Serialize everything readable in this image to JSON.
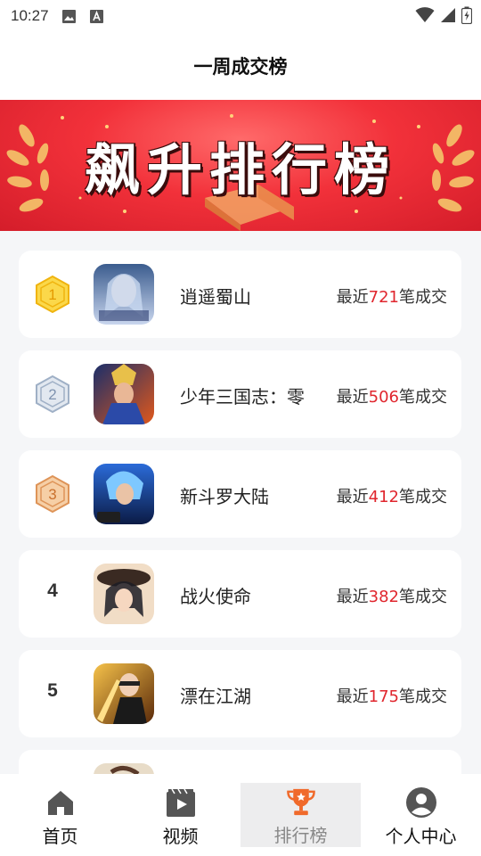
{
  "status_bar": {
    "time": "10:27"
  },
  "header": {
    "title": "一周成交榜"
  },
  "banner": {
    "text": "飙升排行榜"
  },
  "ranking": [
    {
      "rank": "1",
      "name": "逍遥蜀山",
      "prefix": "最近",
      "count": "721",
      "suffix": "笔成交"
    },
    {
      "rank": "2",
      "name": "少年三国志：零",
      "prefix": "最近",
      "count": "506",
      "suffix": "笔成交"
    },
    {
      "rank": "3",
      "name": "新斗罗大陆",
      "prefix": "最近",
      "count": "412",
      "suffix": "笔成交"
    },
    {
      "rank": "4",
      "name": "战火使命",
      "prefix": "最近",
      "count": "382",
      "suffix": "笔成交"
    },
    {
      "rank": "5",
      "name": "漂在江湖",
      "prefix": "最近",
      "count": "175",
      "suffix": "笔成交"
    }
  ],
  "tabs": [
    {
      "label": "首页",
      "icon": "home-icon"
    },
    {
      "label": "视频",
      "icon": "video-icon"
    },
    {
      "label": "排行榜",
      "icon": "trophy-icon",
      "active": true
    },
    {
      "label": "个人中心",
      "icon": "profile-icon"
    }
  ],
  "colors": {
    "accent": "#e0262e",
    "active_tab": "#f06a2b"
  }
}
